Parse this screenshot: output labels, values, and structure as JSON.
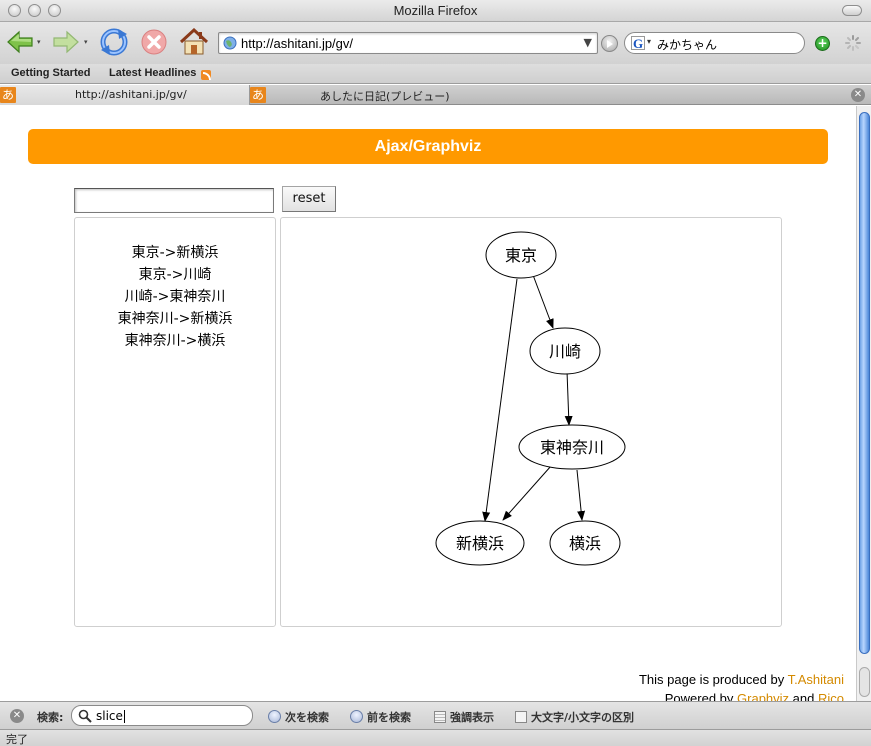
{
  "window": {
    "title": "Mozilla Firefox"
  },
  "navbar": {
    "url": "http://ashitani.jp/gv/",
    "search_value": "みかちゃん",
    "search_engine_glyph": "G",
    "icons": [
      "back-arrow-icon",
      "forward-arrow-icon",
      "reload-icon",
      "stop-icon",
      "home-icon",
      "globe-icon",
      "go-icon",
      "add-icon",
      "spinner-icon"
    ]
  },
  "bookmarks": [
    {
      "label": "Getting Started"
    },
    {
      "label": "Latest Headlines"
    }
  ],
  "tabs": [
    {
      "favicon": "あ",
      "label": "http://ashitani.jp/gv/"
    },
    {
      "favicon": "あ",
      "label": "あしたに日記(プレビュー)"
    }
  ],
  "page": {
    "header": "Ajax/Graphviz",
    "input_value": "",
    "reset_label": "reset",
    "edges_text": [
      "東京->新横浜",
      "東京->川崎",
      "川崎->東神奈川",
      "東神奈川->新横浜",
      "東神奈川->横浜"
    ],
    "graph": {
      "nodes": [
        {
          "id": "tokyo",
          "label": "東京"
        },
        {
          "id": "kawasaki",
          "label": "川崎"
        },
        {
          "id": "higashikanagawa",
          "label": "東神奈川"
        },
        {
          "id": "shinyokohama",
          "label": "新横浜"
        },
        {
          "id": "yokohama",
          "label": "横浜"
        }
      ],
      "edges": [
        {
          "from": "tokyo",
          "to": "shinyokohama"
        },
        {
          "from": "tokyo",
          "to": "kawasaki"
        },
        {
          "from": "kawasaki",
          "to": "higashikanagawa"
        },
        {
          "from": "higashikanagawa",
          "to": "shinyokohama"
        },
        {
          "from": "higashikanagawa",
          "to": "yokohama"
        }
      ]
    },
    "footer": {
      "line1_prefix": "This page is produced by ",
      "line1_link": "T.Ashitani",
      "line2_prefix": "Powered by ",
      "line2_link1": "Graphviz",
      "line2_mid": " and ",
      "line2_link2": "Rico"
    },
    "link_color": "#d48a00",
    "accent_color": "#ff9900"
  },
  "findbar": {
    "label": "検索:",
    "query": "slice",
    "next_label": "次を検索",
    "prev_label": "前を検索",
    "highlight_label": "強調表示",
    "match_case_label": "大文字/小文字の区別"
  },
  "status": {
    "text": "完了"
  }
}
